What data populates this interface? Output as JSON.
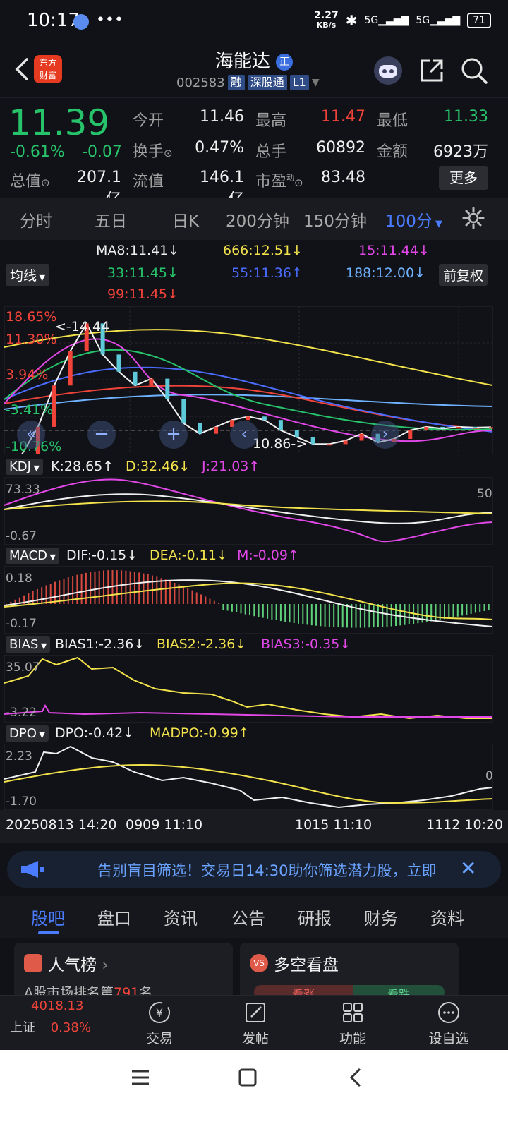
{
  "status_bar": {
    "time": "10:17",
    "net_speed_top": "2.27",
    "net_speed_bottom": "KB/s",
    "signal1": "5G",
    "signal2": "5G",
    "battery": "71"
  },
  "header": {
    "logo_line1": "东方",
    "logo_line2": "财富",
    "stock_name": "海能达",
    "stock_code": "002583",
    "tags": [
      "融",
      "深股通",
      "L1"
    ]
  },
  "quote": {
    "price": "11.39",
    "change_pct": "-0.61%",
    "change_abs": "-0.07",
    "rows": [
      [
        {
          "label": "今开",
          "value": "11.46",
          "color": "white"
        },
        {
          "label": "最高",
          "value": "11.47",
          "color": "red"
        },
        {
          "label": "最低",
          "value": "11.33",
          "color": "green"
        }
      ],
      [
        {
          "label": "换手",
          "value": "0.47%",
          "color": "white"
        },
        {
          "label": "总手",
          "value": "60892",
          "color": "white"
        },
        {
          "label": "金额",
          "value": "6923万",
          "color": "white"
        }
      ],
      [
        {
          "label": "总值",
          "value": "207.1亿",
          "color": "white"
        },
        {
          "label": "流值",
          "value": "146.1亿",
          "color": "white"
        },
        {
          "label": "市盈",
          "value": "83.48",
          "color": "white"
        }
      ]
    ],
    "pe_superscript": "动",
    "more_label": "更多"
  },
  "period_tabs": [
    "分时",
    "五日",
    "日K",
    "200分钟",
    "150分钟",
    "100分"
  ],
  "chart_data": {
    "type": "line",
    "ma_selector": "均线",
    "adjust_label": "前复权",
    "ma_legend": [
      {
        "text": "MA8:11.41↓",
        "color": "#f0f0f0"
      },
      {
        "text": "666:12.51↓",
        "color": "#f2e24b"
      },
      {
        "text": "15:11.44↓",
        "color": "#e247e8"
      },
      {
        "text": "33:11.45↓",
        "color": "#27c36b"
      },
      {
        "text": "55:11.36↑",
        "color": "#4b6cff"
      },
      {
        "text": "188:12.00↓",
        "color": "#6fb2ff"
      },
      {
        "text": "99:11.45↓",
        "color": "#f0443a"
      }
    ],
    "main_axis_labels": [
      "18.65%",
      "11.30%",
      "3.94%",
      "-3.41%",
      "-10.76%"
    ],
    "high_marker": "<-14.44",
    "low_marker": "10.86->",
    "kdj": {
      "selector": "KDJ",
      "k": "K:28.65↑",
      "d": "D:32.46↓",
      "j": "J:21.03↑",
      "top": "73.33",
      "bottom": "-0.67",
      "right": "50"
    },
    "macd": {
      "selector": "MACD",
      "dif": "DIF:-0.15↓",
      "dea": "DEA:-0.11↓",
      "m": "M:-0.09↑",
      "top": "0.18",
      "bottom": "-0.17"
    },
    "bias": {
      "selector": "BIAS",
      "b1": "BIAS1:-2.36↓",
      "b2": "BIAS2:-2.36↓",
      "b3": "BIAS3:-0.35↓",
      "top": "35.07",
      "bottom": "-3.22"
    },
    "dpo": {
      "selector": "DPO",
      "dpo": "DPO:-0.42↓",
      "madpo": "MADPO:-0.99↑",
      "top": "2.23",
      "bottom": "-1.70",
      "right": "0"
    },
    "x_labels": [
      "20250813 14:20",
      "0909 11:10",
      "1015 11:10",
      "1112 10:20"
    ],
    "close_series": [
      10.3,
      10.6,
      11.4,
      12.6,
      13.6,
      14.4,
      13.5,
      13.0,
      12.6,
      12.8,
      12.2,
      11.5,
      11.2,
      11.4,
      11.6,
      11.7,
      11.6,
      11.3,
      11.1,
      10.9,
      10.9,
      11.0,
      11.2,
      10.95,
      11.05,
      11.3,
      11.4,
      11.35,
      11.4,
      11.38,
      11.39
    ],
    "series_colors": {
      "ma8": "#f0f0f0",
      "ma666": "#f2e24b",
      "ma15": "#e247e8",
      "ma33": "#27c36b",
      "ma55": "#4b6cff",
      "ma188": "#6fb2ff",
      "ma99": "#f0443a"
    }
  },
  "banner": {
    "text": "告别盲目筛选！交易日14:30助你筛选潜力股，立即"
  },
  "info_tabs": [
    "股吧",
    "盘口",
    "资讯",
    "公告",
    "研报",
    "财务",
    "资料"
  ],
  "cards": {
    "left_title": "人气榜",
    "left_sub_prefix": "A股市场排名第",
    "left_sub_rank": "791",
    "left_sub_suffix": "名",
    "right_title": "多空看盘",
    "right_bull": "看涨",
    "right_bear": "看跌"
  },
  "bottom_bar": {
    "index_value": "4018.13",
    "index_name": "上证",
    "index_change": "0.38%",
    "items": [
      "交易",
      "发帖",
      "功能",
      "设自选"
    ]
  }
}
